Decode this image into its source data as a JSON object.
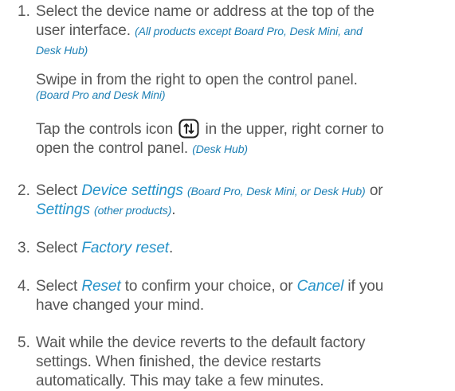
{
  "steps": [
    {
      "number": "1.",
      "paragraphs": [
        {
          "text1": "Select the device name or address at the top of the",
          "text2": "user interface.",
          "note_a": "(All products except Board Pro, Desk Mini, and",
          "note_b": "Desk Hub)"
        },
        {
          "text1": "Swipe in from the right to open the control panel.",
          "note": "(Board Pro and Desk Mini)"
        },
        {
          "text_before_icon": "Tap the controls icon",
          "icon": "controls-icon",
          "text_after_icon": "in the upper, right corner to",
          "text2": "open the control panel.",
          "note": "(Desk Hub)"
        }
      ]
    },
    {
      "number": "2.",
      "text_select": "Select",
      "link1": "Device settings",
      "note1": "(Board Pro, Desk Mini, or Desk Hub)",
      "text_or": "or",
      "link2": "Settings",
      "note2": "(other products)",
      "end": "."
    },
    {
      "number": "3.",
      "text_select": "Select",
      "link": "Factory reset",
      "end": "."
    },
    {
      "number": "4.",
      "text_select": "Select",
      "link1": "Reset",
      "text_mid": "to confirm your choice, or",
      "link2": "Cancel",
      "text_end": "if you",
      "text2": "have changed your mind."
    },
    {
      "number": "5.",
      "line1": "Wait while the device reverts to the default factory",
      "line2": "settings. When finished, the device restarts",
      "line3": "automatically. This may take a few minutes."
    }
  ],
  "colors": {
    "body_text": "#555555",
    "link": "#2693c9",
    "note": "#1c7fb4",
    "icon_stroke": "#222222"
  }
}
